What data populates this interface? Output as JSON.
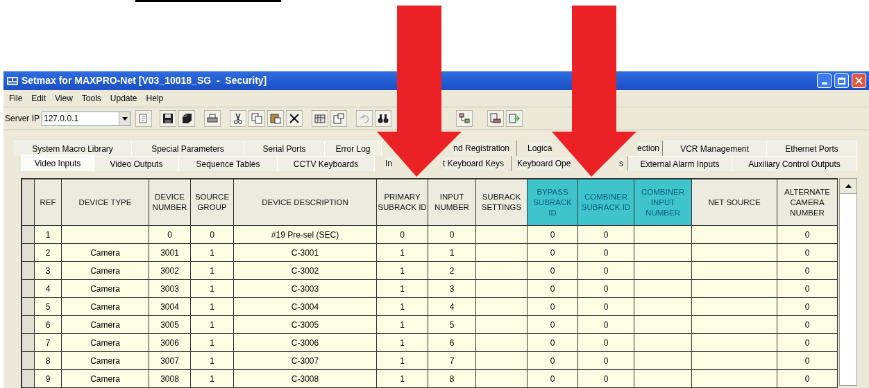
{
  "window": {
    "title": "Setmax for MAXPRO-Net [V03_10018_SG  -  Security]"
  },
  "menu": [
    "File",
    "Edit",
    "View",
    "Tools",
    "Update",
    "Help"
  ],
  "toolbar": {
    "server_ip_label": "Server IP",
    "server_ip": "127.0.0.1"
  },
  "tab_rows": [
    [
      {
        "label": "System Macro Library",
        "selected": false
      },
      {
        "label": "Special Parameters",
        "selected": false
      },
      {
        "label": "Serial Ports",
        "selected": false
      },
      {
        "label": "Error Log",
        "selected": false
      },
      {
        "label_parts": [
          "nd Registration"
        ],
        "selected": false
      },
      {
        "label_parts": [
          "Logica",
          "ection"
        ],
        "selected": false
      },
      {
        "label": "VCR Management",
        "selected": false
      },
      {
        "label": "Ethernet Ports",
        "selected": false
      }
    ],
    [
      {
        "label": "Video Inputs",
        "selected": true
      },
      {
        "label": "Video Outputs",
        "selected": false
      },
      {
        "label": "Sequence Tables",
        "selected": false
      },
      {
        "label": "CCTV Keyboards",
        "selected": false
      },
      {
        "label_parts": [
          "In",
          "t Keyboard Keys"
        ],
        "selected": false
      },
      {
        "label_parts": [
          "Keyboard Ope",
          "s"
        ],
        "selected": false
      },
      {
        "label": "External Alarm Inputs",
        "selected": false
      },
      {
        "label": "Auxiliary Control Outputs",
        "selected": false
      }
    ]
  ],
  "table": {
    "columns": [
      {
        "label": "REF",
        "highlighted": false
      },
      {
        "label": "DEVICE TYPE",
        "highlighted": false
      },
      {
        "label": "DEVICE NUMBER",
        "highlighted": false
      },
      {
        "label": "SOURCE GROUP",
        "highlighted": false
      },
      {
        "label": "DEVICE DESCRIPTION",
        "highlighted": false
      },
      {
        "label": "PRIMARY SUBRACK ID",
        "highlighted": false
      },
      {
        "label": "INPUT NUMBER",
        "highlighted": false
      },
      {
        "label": "SUBRACK SETTINGS",
        "highlighted": false
      },
      {
        "label": "BYPASS SUBRACK ID",
        "highlighted": true
      },
      {
        "label": "COMBINER SUBRACK ID",
        "highlighted": true
      },
      {
        "label": "COMBINER INPUT NUMBER",
        "highlighted": true
      },
      {
        "label": "NET SOURCE",
        "highlighted": false
      },
      {
        "label": "ALTERNATE CAMERA NUMBER",
        "highlighted": false
      }
    ],
    "rows": [
      [
        "1",
        null,
        "0",
        "0",
        "#19 Pre-sel (SEC)",
        "0",
        "0",
        null,
        "0",
        "0",
        null,
        null,
        "0"
      ],
      [
        "2",
        "Camera",
        "3001",
        "1",
        "C-3001",
        "1",
        "1",
        null,
        "0",
        "0",
        null,
        null,
        "0"
      ],
      [
        "3",
        "Camera",
        "3002",
        "1",
        "C-3002",
        "1",
        "2",
        null,
        "0",
        "0",
        null,
        null,
        "0"
      ],
      [
        "4",
        "Camera",
        "3003",
        "1",
        "C-3003",
        "1",
        "3",
        null,
        "0",
        "0",
        null,
        null,
        "0"
      ],
      [
        "5",
        "Camera",
        "3004",
        "1",
        "C-3004",
        "1",
        "4",
        null,
        "0",
        "0",
        null,
        null,
        "0"
      ],
      [
        "6",
        "Camera",
        "3005",
        "1",
        "C-3005",
        "1",
        "5",
        null,
        "0",
        "0",
        null,
        null,
        "0"
      ],
      [
        "7",
        "Camera",
        "3006",
        "1",
        "C-3006",
        "1",
        "6",
        null,
        "0",
        "0",
        null,
        null,
        "0"
      ],
      [
        "8",
        "Camera",
        "3007",
        "1",
        "C-3007",
        "1",
        "7",
        null,
        "0",
        "0",
        null,
        null,
        "0"
      ],
      [
        "9",
        "Camera",
        "3008",
        "1",
        "C-3008",
        "1",
        "8",
        null,
        "0",
        "0",
        null,
        null,
        "0"
      ]
    ]
  }
}
